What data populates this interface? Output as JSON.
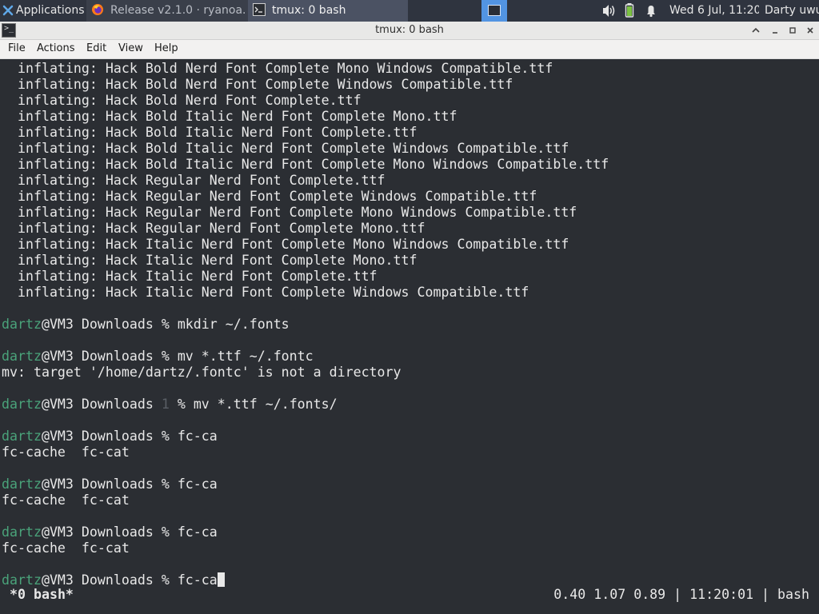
{
  "panel": {
    "apps_label": "Applications",
    "tasks": [
      {
        "label": "Release v2.1.0 · ryanoa..."
      },
      {
        "label": "tmux: 0 bash"
      }
    ],
    "clock": "Wed  6 Jul, 11:20",
    "user": "Darty uwu"
  },
  "window": {
    "title": "tmux: 0 bash",
    "menu": [
      "File",
      "Actions",
      "Edit",
      "View",
      "Help"
    ]
  },
  "terminal": {
    "inflate_prefix": "  inflating: ",
    "inflated_files": [
      "Hack Bold Nerd Font Complete Mono Windows Compatible.ttf",
      "Hack Bold Nerd Font Complete Windows Compatible.ttf",
      "Hack Bold Nerd Font Complete.ttf",
      "Hack Bold Italic Nerd Font Complete Mono.ttf",
      "Hack Bold Italic Nerd Font Complete.ttf",
      "Hack Bold Italic Nerd Font Complete Windows Compatible.ttf",
      "Hack Bold Italic Nerd Font Complete Mono Windows Compatible.ttf",
      "Hack Regular Nerd Font Complete.ttf",
      "Hack Regular Nerd Font Complete Windows Compatible.ttf",
      "Hack Regular Nerd Font Complete Mono Windows Compatible.ttf",
      "Hack Regular Nerd Font Complete Mono.ttf",
      "Hack Italic Nerd Font Complete Mono Windows Compatible.ttf",
      "Hack Italic Nerd Font Complete Mono.ttf",
      "Hack Italic Nerd Font Complete.ttf",
      "Hack Italic Nerd Font Complete Windows Compatible.ttf"
    ],
    "prompt_user": "dartz",
    "prompt_host_dir": "@VM3 Downloads ",
    "prompt_symbol": "%",
    "error_status": "1",
    "commands": [
      {
        "cmd": "mkdir ~/.fonts"
      },
      {
        "cmd": "mv *.ttf ~/.fontc"
      },
      {
        "cmd": "mv *.ttf ~/.fonts/"
      },
      {
        "cmd": "fc-ca"
      },
      {
        "cmd": "fc-ca"
      },
      {
        "cmd": "fc-ca"
      },
      {
        "cmd": "fc-ca"
      }
    ],
    "outputs": {
      "mv_error": "mv: target '/home/dartz/.fontc' is not a directory",
      "completion": "fc-cache  fc-cat"
    }
  },
  "tmux": {
    "window_label": "*0 bash*",
    "status_right": "0.40 1.07 0.89 | 11:20:01 | bash"
  }
}
